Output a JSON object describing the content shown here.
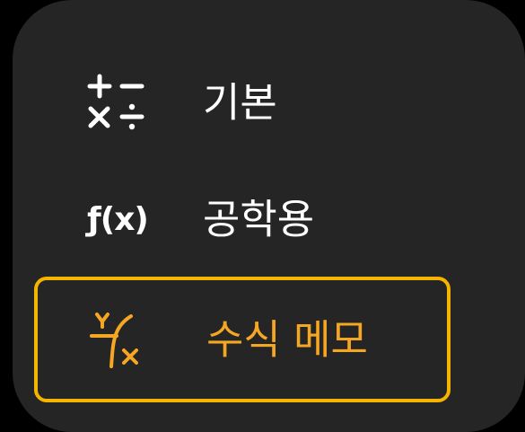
{
  "menu": {
    "items": [
      {
        "label": "기본",
        "icon": "basic-operators-icon",
        "selected": false
      },
      {
        "label": "공학용",
        "icon": "function-fx-icon",
        "icon_text": "ƒ(x)",
        "selected": false
      },
      {
        "label": "수식 메모",
        "icon": "graph-xy-icon",
        "selected": true
      }
    ]
  },
  "colors": {
    "background": "#252525",
    "text": "#ffffff",
    "accent": "#f5a623",
    "selected_border": "#f5b400"
  }
}
